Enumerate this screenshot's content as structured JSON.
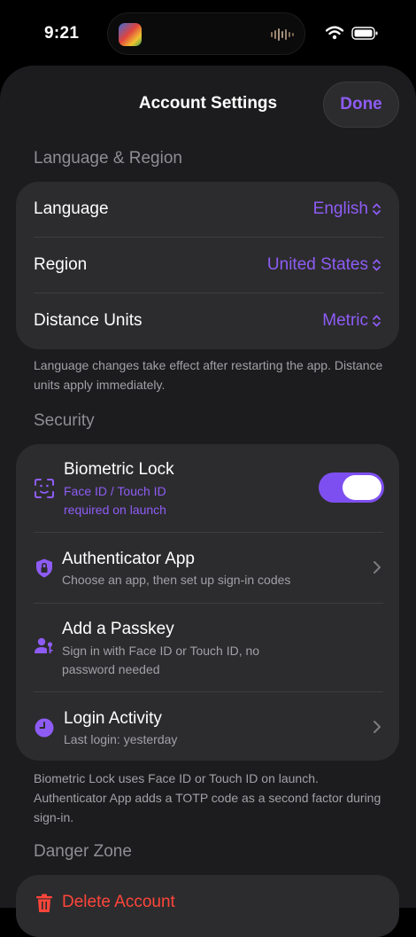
{
  "status_bar": {
    "time": "9:21"
  },
  "nav": {
    "title": "Account Settings",
    "done_label": "Done"
  },
  "language_region": {
    "header": "Language & Region",
    "rows": [
      {
        "label": "Language",
        "value": "English"
      },
      {
        "label": "Region",
        "value": "United States"
      },
      {
        "label": "Distance Units",
        "value": "Metric"
      }
    ],
    "footer": "Language changes take effect after restarting the app. Distance units apply immediately."
  },
  "security": {
    "header": "Security",
    "biometric": {
      "title": "Biometric Lock",
      "subtitle_line1": "Face ID / Touch ID",
      "subtitle_line2": "required on launch",
      "enabled": true,
      "icon": "face-id-icon"
    },
    "authenticator": {
      "title": "Authenticator App",
      "subtitle": "Choose an app, then set up sign-in codes",
      "icon": "shield-lock-icon"
    },
    "passkey": {
      "title": "Add a Passkey",
      "subtitle_line1": "Sign in with Face ID or Touch ID, no",
      "subtitle_line2": "password needed",
      "icon": "person-key-icon"
    },
    "login_activity": {
      "title": "Login Activity",
      "subtitle": "Last login: yesterday",
      "icon": "clock-icon"
    },
    "footer": "Biometric Lock uses Face ID or Touch ID on launch. Authenticator App adds a TOTP code as a second factor during sign-in."
  },
  "danger_zone": {
    "header": "Danger Zone",
    "delete_label": "Delete Account",
    "icon": "trash-icon"
  },
  "colors": {
    "accent": "#8e5cf5",
    "destructive": "#ff453a",
    "group_bg": "#2c2c2e",
    "sheet_bg": "#1c1c1e"
  }
}
